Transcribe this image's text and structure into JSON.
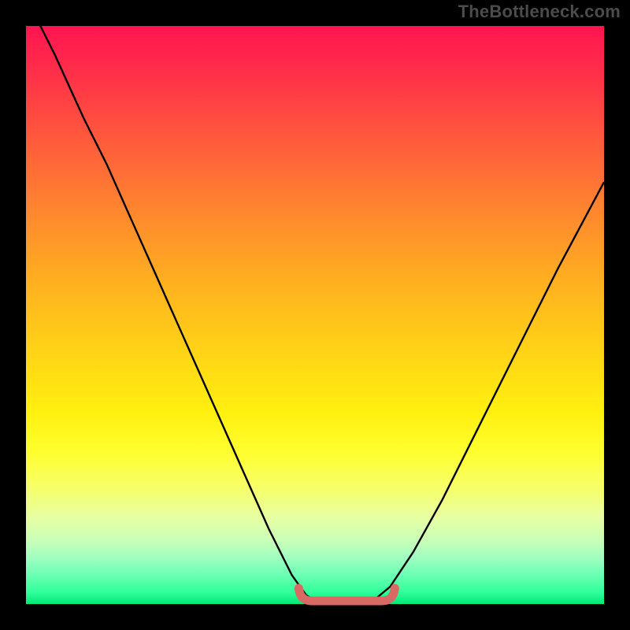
{
  "watermark": "TheBottleneck.com",
  "colors": {
    "page_bg": "#000000",
    "grad_top": "#ff1450",
    "grad_mid1": "#ff8a2d",
    "grad_mid2": "#ffe015",
    "grad_bottom": "#00e874",
    "curve": "#000000",
    "annotation": "#d96a63"
  },
  "chart_data": {
    "type": "line",
    "title": "",
    "xlabel": "",
    "ylabel": "",
    "xlim": [
      0,
      100
    ],
    "ylim": [
      0,
      100
    ],
    "series": [
      {
        "name": "bottleneck-curve",
        "x": [
          0,
          5,
          10,
          14,
          18,
          22,
          26,
          30,
          34,
          38,
          42,
          46,
          48.5,
          51,
          54,
          57,
          60,
          63,
          67,
          72,
          78,
          85,
          92,
          100
        ],
        "y": [
          105,
          95,
          84,
          76,
          67,
          58,
          49,
          40,
          31,
          22,
          13,
          5,
          1.5,
          0,
          0,
          0,
          0.5,
          3,
          9,
          18,
          30,
          44,
          58,
          73
        ]
      }
    ],
    "annotations": [
      {
        "name": "flat-minimum",
        "x_start": 48,
        "x_end": 63,
        "y": 0
      }
    ]
  }
}
